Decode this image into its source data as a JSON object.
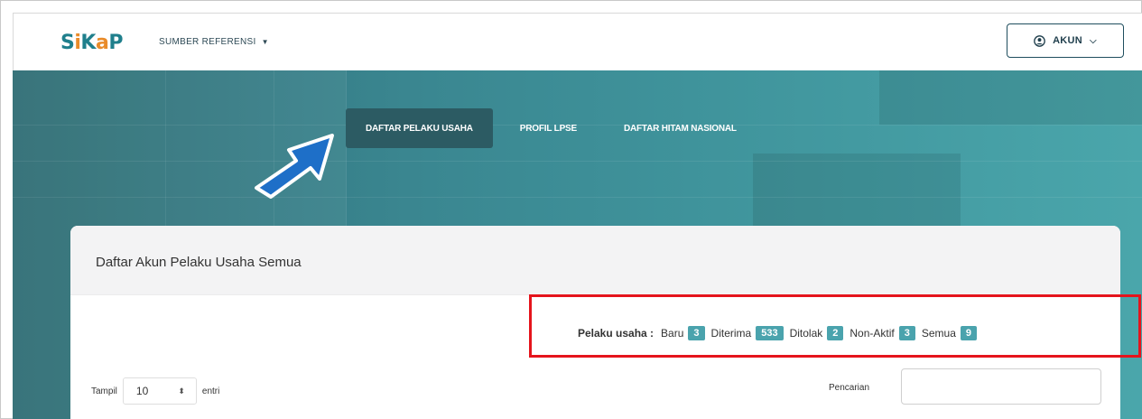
{
  "logo": {
    "s": "S",
    "i": "i",
    "k": "K",
    "a": "a",
    "p": "P"
  },
  "nav": {
    "reference_menu": "SUMBER REFERENSI",
    "account_button": "AKUN"
  },
  "tabs": [
    {
      "label": "DAFTAR PELAKU USAHA",
      "active": true
    },
    {
      "label": "PROFIL LPSE",
      "active": false
    },
    {
      "label": "DAFTAR HITAM NASIONAL",
      "active": false
    }
  ],
  "card": {
    "title": "Daftar Akun Pelaku Usaha Semua"
  },
  "status": {
    "label": "Pelaku usaha :",
    "items": [
      {
        "label": "Baru",
        "count": "3"
      },
      {
        "label": "Diterima",
        "count": "533"
      },
      {
        "label": "Ditolak",
        "count": "2"
      },
      {
        "label": "Non-Aktif",
        "count": "3"
      },
      {
        "label": "Semua",
        "count": "9"
      }
    ]
  },
  "table_controls": {
    "show_prefix": "Tampil",
    "show_value": "10",
    "show_suffix": "entri",
    "search_label": "Pencarian",
    "search_value": ""
  },
  "colors": {
    "brand_teal": "#1f7f8c",
    "brand_orange": "#e98b2a",
    "badge": "#4aa3ad",
    "highlight": "#e5141c",
    "arrow": "#1e6fc8"
  }
}
